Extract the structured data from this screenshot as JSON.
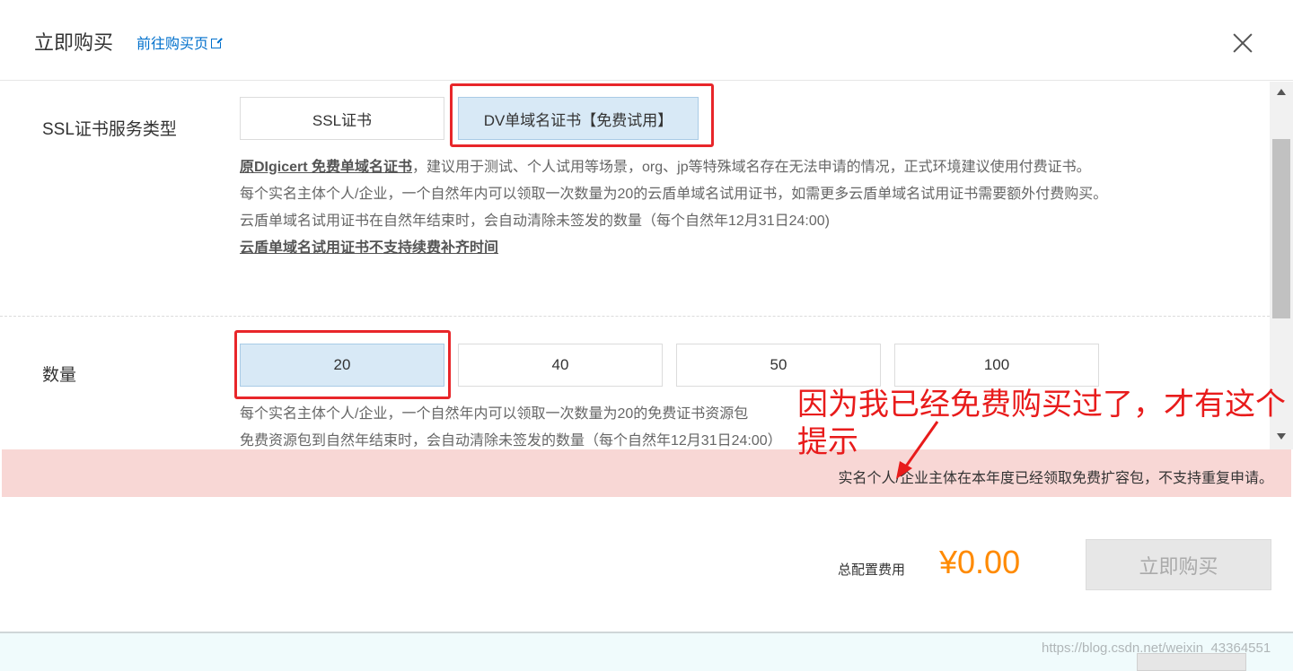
{
  "header": {
    "title": "立即购买",
    "buy_page_link": "前往购买页"
  },
  "ssl_section": {
    "label": "SSL证书服务类型",
    "options": [
      "SSL证书",
      "DV单域名证书【免费试用】"
    ],
    "selected": "DV单域名证书【免费试用】",
    "desc_line1_bold": "原DIgicert 免费单域名证书",
    "desc_line1_rest": "，建议用于测试、个人试用等场景，org、jp等特殊域名存在无法申请的情况，正式环境建议使用付费证书。",
    "desc_line2": "每个实名主体个人/企业，一个自然年内可以领取一次数量为20的云盾单域名试用证书，如需更多云盾单域名试用证书需要额外付费购买。",
    "desc_line3": "云盾单域名试用证书在自然年结束时，会自动清除未签发的数量（每个自然年12月31日24:00)",
    "desc_line4_bold": "云盾单域名试用证书不支持续费补齐时间"
  },
  "quantity_section": {
    "label": "数量",
    "options": [
      "20",
      "40",
      "50",
      "100"
    ],
    "selected": "20",
    "desc_line1": "每个实名主体个人/企业，一个自然年内可以领取一次数量为20的免费证书资源包",
    "desc_line2": "免费资源包到自然年结束时，会自动清除未签发的数量（每个自然年12月31日24:00）"
  },
  "alert": {
    "text": "实名个人/企业主体在本年度已经领取免费扩容包，不支持重复申请。"
  },
  "annotation": {
    "text": "因为我已经免费购买过了，才有这个提示"
  },
  "footer": {
    "total_label": "总配置费用",
    "price": "¥0.00",
    "buy_button": "立即购买"
  },
  "watermark": "https://blog.csdn.net/weixin_43364551",
  "colors": {
    "price": "#ff8a00",
    "link": "#0070cc",
    "selected_bg": "#d8e9f6",
    "alert_bg": "#f8d7d5",
    "annotation": "#e81b1b"
  }
}
